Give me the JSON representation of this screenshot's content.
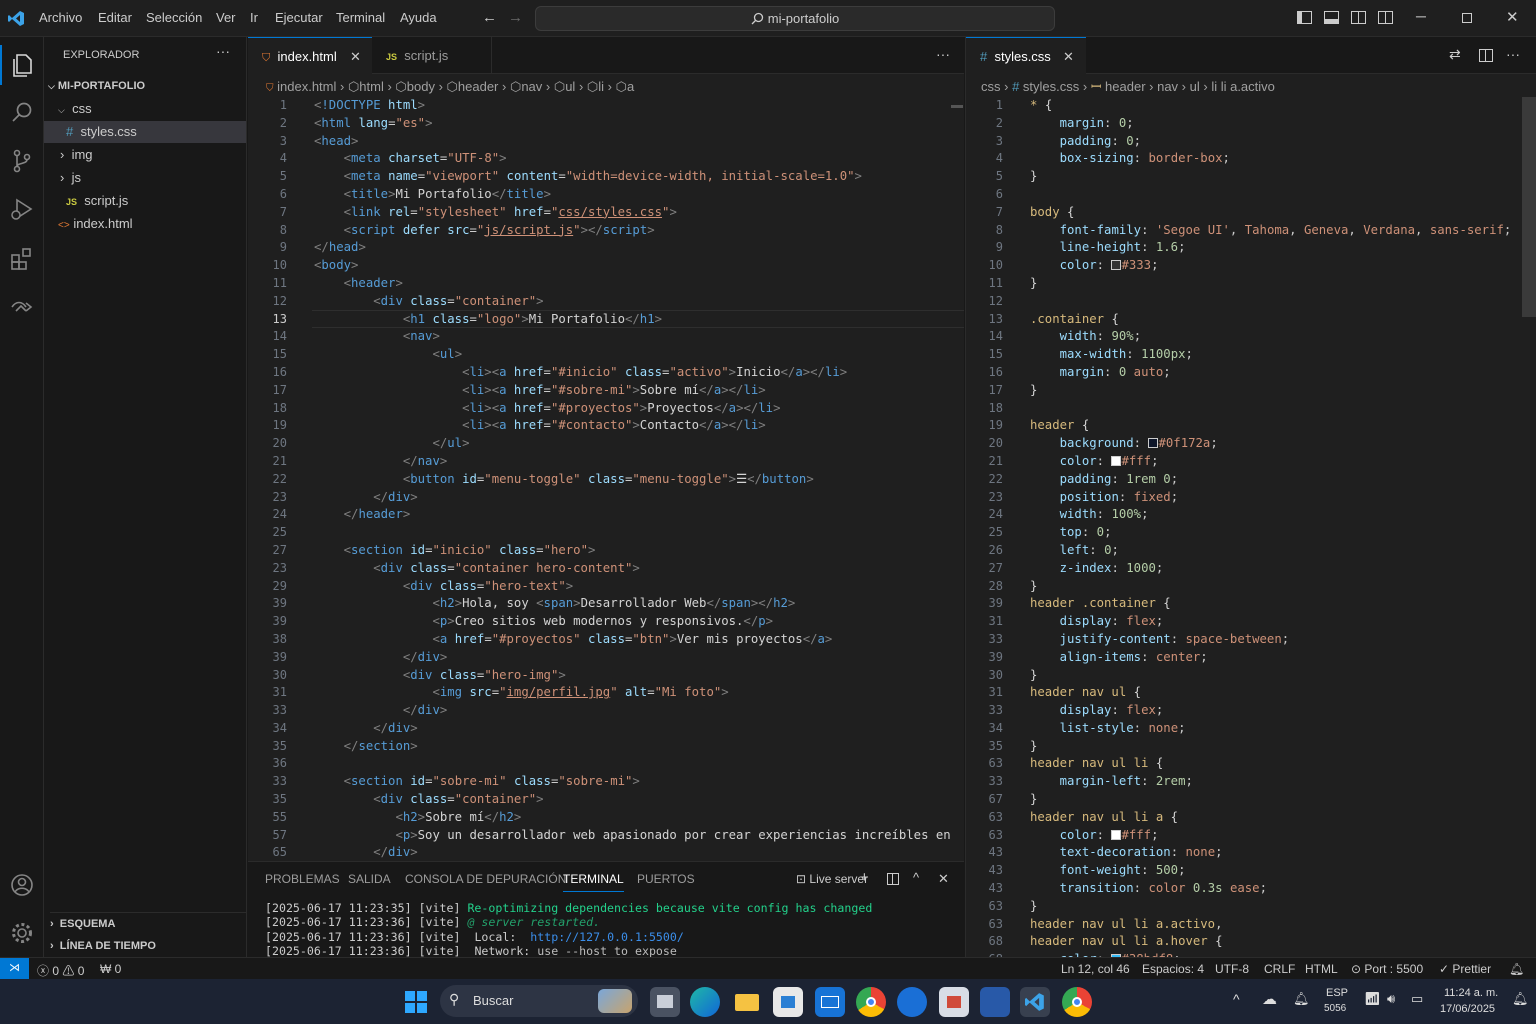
{
  "titlebar": {
    "menu": [
      "Archivo",
      "Editar",
      "Selección",
      "Ver",
      "Ir",
      "Ejecutar",
      "Terminal",
      "Ayuda"
    ],
    "search": "mi-portafolio"
  },
  "sidebar": {
    "title": "EXPLORADOR",
    "project": "MI-PORTAFOLIO",
    "items": [
      {
        "label": "css"
      },
      {
        "label": "styles.css"
      },
      {
        "label": "img"
      },
      {
        "label": "js"
      },
      {
        "label": "script.js"
      },
      {
        "label": "index.html"
      }
    ],
    "outline": "ESQUEMA",
    "timeline": "LÍNEA DE TIEMPO"
  },
  "editor_left": {
    "tabs": [
      "index.html",
      "script.js"
    ],
    "breadcrumb": [
      "index.html",
      "html",
      "body",
      "header",
      "nav",
      "ul",
      "li",
      "a"
    ],
    "line_numbers": [
      "1",
      "2",
      "3",
      "4",
      "5",
      "6",
      "7",
      "8",
      "9",
      "10",
      "11",
      "12",
      "13",
      "14",
      "15",
      "16",
      "17",
      "18",
      "19",
      "20",
      "21",
      "22",
      "23",
      "24",
      "25",
      "27",
      "23",
      "29",
      "39",
      "39",
      "38",
      "39",
      "30",
      "31",
      "33",
      "34",
      "35",
      "36",
      "33",
      "35",
      "55",
      "57",
      "65"
    ]
  },
  "editor_right": {
    "tab": "styles.css",
    "breadcrumb": [
      "css",
      "styles.css",
      "header",
      "nav",
      "ul",
      "li li a.activo"
    ],
    "line_numbers": [
      "1",
      "2",
      "3",
      "4",
      "5",
      "6",
      "7",
      "8",
      "9",
      "10",
      "11",
      "12",
      "13",
      "14",
      "15",
      "16",
      "17",
      "18",
      "19",
      "20",
      "21",
      "22",
      "23",
      "24",
      "25",
      "26",
      "27",
      "28",
      "39",
      "31",
      "33",
      "39",
      "30",
      "31",
      "33",
      "34",
      "35",
      "63",
      "33",
      "67",
      "63",
      "63",
      "43",
      "43",
      "43",
      "63",
      "63",
      "68",
      "68"
    ]
  },
  "panel": {
    "tabs": [
      "PROBLEMAS",
      "SALIDA",
      "CONSOLA DE DEPURACIÓN",
      "TERMINAL",
      "PUERTOS"
    ],
    "live": "Live server",
    "lines": [
      {
        "time": "[2025-06-17 11:23:35]",
        "tag": "[vite]",
        "msg": "Re-optimizing dependencies because vite config has changed"
      },
      {
        "time": "[2025-06-17 11:23:36]",
        "tag": "[vite]",
        "msg": "@ server restarted."
      },
      {
        "time": "[2025-06-17 11:23:36]",
        "tag": "[vite]",
        "msg": "Local:",
        "url": "http://127.0.0.1:5500/"
      },
      {
        "time": "[2025-06-17 11:23:36]",
        "tag": "[vite]",
        "msg": "Network:",
        "url": "use --host to expose"
      }
    ]
  },
  "status": {
    "errors": "0",
    "warnings": "0",
    "ports": "0",
    "position": "Ln 12, col 46",
    "spaces": "Espacios: 4",
    "encoding": "UTF-8",
    "eol": "CRLF",
    "lang": "HTML",
    "port": "Port : 5500",
    "formatter": "Prettier"
  },
  "taskbar": {
    "search": "Buscar",
    "lang": "ESP",
    "lang2": "5056",
    "time": "11:24 a. m.",
    "date": "17/06/2025"
  },
  "colors": {
    "accent": "#0078d4",
    "html_icon": "#e37933",
    "js_icon": "#cbcb41",
    "css_icon": "#519aba"
  }
}
